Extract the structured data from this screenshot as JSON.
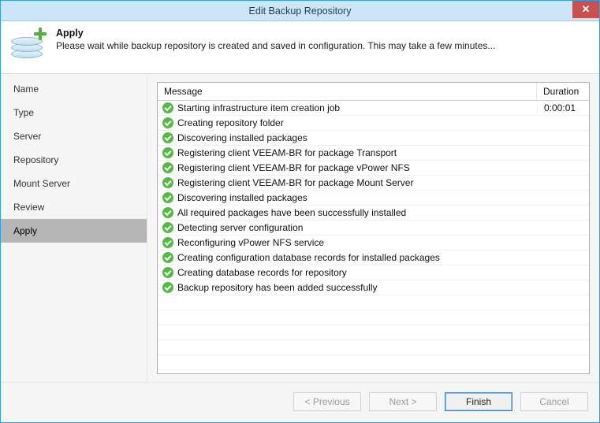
{
  "window": {
    "title": "Edit Backup Repository"
  },
  "header": {
    "heading": "Apply",
    "description": "Please wait while backup repository is created and saved in configuration. This may take a few minutes..."
  },
  "sidebar": {
    "items": [
      {
        "label": "Name",
        "active": false
      },
      {
        "label": "Type",
        "active": false
      },
      {
        "label": "Server",
        "active": false
      },
      {
        "label": "Repository",
        "active": false
      },
      {
        "label": "Mount Server",
        "active": false
      },
      {
        "label": "Review",
        "active": false
      },
      {
        "label": "Apply",
        "active": true
      }
    ]
  },
  "grid": {
    "columns": {
      "message": "Message",
      "duration": "Duration"
    },
    "rows": [
      {
        "msg": "Starting infrastructure item creation job",
        "dur": "0:00:01"
      },
      {
        "msg": "Creating repository folder",
        "dur": ""
      },
      {
        "msg": "Discovering installed packages",
        "dur": ""
      },
      {
        "msg": "Registering client VEEAM-BR for package Transport",
        "dur": ""
      },
      {
        "msg": "Registering client VEEAM-BR for package vPower NFS",
        "dur": ""
      },
      {
        "msg": "Registering client VEEAM-BR for package Mount Server",
        "dur": ""
      },
      {
        "msg": "Discovering installed packages",
        "dur": ""
      },
      {
        "msg": "All required packages have been successfully installed",
        "dur": ""
      },
      {
        "msg": "Detecting server configuration",
        "dur": ""
      },
      {
        "msg": "Reconfiguring vPower NFS service",
        "dur": ""
      },
      {
        "msg": "Creating configuration database records for installed packages",
        "dur": ""
      },
      {
        "msg": "Creating database records for repository",
        "dur": ""
      },
      {
        "msg": "Backup repository has been added successfully",
        "dur": ""
      }
    ]
  },
  "footer": {
    "previous": "< Previous",
    "next": "Next >",
    "finish": "Finish",
    "cancel": "Cancel"
  }
}
